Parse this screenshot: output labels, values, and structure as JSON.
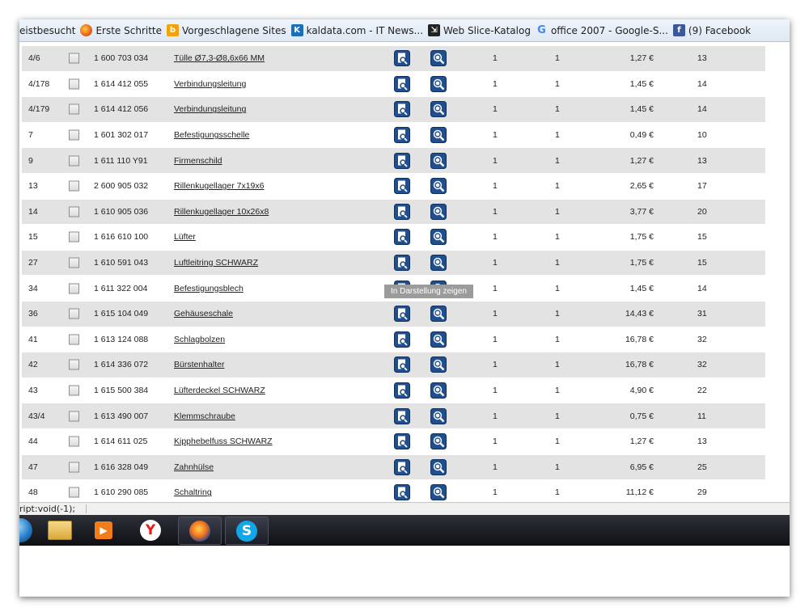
{
  "favorites": [
    {
      "label": "eistbesucht",
      "icon": "none"
    },
    {
      "label": "Erste Schritte",
      "icon": "firefox-icon"
    },
    {
      "label": "Vorgeschlagene Sites",
      "icon": "bing-icon"
    },
    {
      "label": "kaldata.com - IT News...",
      "icon": "kaldata-icon"
    },
    {
      "label": "Web Slice-Katalog",
      "icon": "webslice-icon"
    },
    {
      "label": "office 2007 - Google-S...",
      "icon": "google-icon"
    },
    {
      "label": "(9) Facebook",
      "icon": "facebook-icon"
    }
  ],
  "rows": [
    {
      "pos": "4/6",
      "number": "1 600 703 034",
      "name": "Tülle Ø7,3-Ø8,6x66 MM",
      "qty1": "1",
      "qty2": "1",
      "price": "1,27 €",
      "n": "13"
    },
    {
      "pos": "4/178",
      "number": "1 614 412 055",
      "name": "Verbindungsleitung",
      "qty1": "1",
      "qty2": "1",
      "price": "1,45 €",
      "n": "14"
    },
    {
      "pos": "4/179",
      "number": "1 614 412 056",
      "name": "Verbindungsleitung",
      "qty1": "1",
      "qty2": "1",
      "price": "1,45 €",
      "n": "14"
    },
    {
      "pos": "7",
      "number": "1 601 302 017",
      "name": "Befestigungsschelle",
      "qty1": "1",
      "qty2": "1",
      "price": "0,49 €",
      "n": "10"
    },
    {
      "pos": "9",
      "number": "1 611 110 Y91",
      "name": "Firmenschild",
      "qty1": "1",
      "qty2": "1",
      "price": "1,27 €",
      "n": "13"
    },
    {
      "pos": "13",
      "number": "2 600 905 032",
      "name": "Rillenkugellager 7x19x6",
      "qty1": "1",
      "qty2": "1",
      "price": "2,65 €",
      "n": "17"
    },
    {
      "pos": "14",
      "number": "1 610 905 036",
      "name": "Rillenkugellager 10x26x8",
      "qty1": "1",
      "qty2": "1",
      "price": "3,77 €",
      "n": "20"
    },
    {
      "pos": "15",
      "number": "1 616 610 100",
      "name": "Lüfter",
      "qty1": "1",
      "qty2": "1",
      "price": "1,75 €",
      "n": "15"
    },
    {
      "pos": "27",
      "number": "1 610 591 043",
      "name": "Luftleitring SCHWARZ",
      "qty1": "1",
      "qty2": "1",
      "price": "1,75 €",
      "n": "15"
    },
    {
      "pos": "34",
      "number": "1 611 322 004",
      "name": "Befestigungsblech",
      "qty1": "1",
      "qty2": "1",
      "price": "1,45 €",
      "n": "14"
    },
    {
      "pos": "36",
      "number": "1 615 104 049",
      "name": "Gehäuseschale",
      "qty1": "1",
      "qty2": "1",
      "price": "14,43 €",
      "n": "31"
    },
    {
      "pos": "41",
      "number": "1 613 124 088",
      "name": "Schlagbolzen",
      "qty1": "1",
      "qty2": "1",
      "price": "16,78 €",
      "n": "32"
    },
    {
      "pos": "42",
      "number": "1 614 336 072",
      "name": "Bürstenhalter",
      "qty1": "1",
      "qty2": "1",
      "price": "16,78 €",
      "n": "32"
    },
    {
      "pos": "43",
      "number": "1 615 500 384",
      "name": "Lüfterdeckel SCHWARZ",
      "qty1": "1",
      "qty2": "1",
      "price": "4,90 €",
      "n": "22"
    },
    {
      "pos": "43/4",
      "number": "1 613 490 007",
      "name": "Klemmschraube",
      "qty1": "1",
      "qty2": "1",
      "price": "0,75 €",
      "n": "11"
    },
    {
      "pos": "44",
      "number": "1 614 611 025",
      "name": "Kipphebelfuss SCHWARZ",
      "qty1": "1",
      "qty2": "1",
      "price": "1,27 €",
      "n": "13"
    },
    {
      "pos": "47",
      "number": "1 616 328 049",
      "name": "Zahnhülse",
      "qty1": "1",
      "qty2": "1",
      "price": "6,95 €",
      "n": "25"
    },
    {
      "pos": "48",
      "number": "1 610 290 085",
      "name": "Schaltring",
      "qty1": "1",
      "qty2": "1",
      "price": "11,12 €",
      "n": "29"
    }
  ],
  "tooltip": "In Darstellung zeigen",
  "status": "ript:void(-1);",
  "taskbar": [
    {
      "app": "Start",
      "icon": "windows-orb-icon"
    },
    {
      "app": "Explorer",
      "icon": "explorer-icon"
    },
    {
      "app": "Media",
      "icon": "media-player-icon"
    },
    {
      "app": "Yandex",
      "icon": "yandex-icon"
    },
    {
      "app": "Firefox",
      "icon": "firefox-icon"
    },
    {
      "app": "Skype",
      "icon": "skype-icon"
    }
  ],
  "colors": {
    "row_shade": "#e3e3e3",
    "button_blue": "#1f4f8f",
    "favbar": "#e6eef7",
    "taskbar": "#14161b"
  }
}
